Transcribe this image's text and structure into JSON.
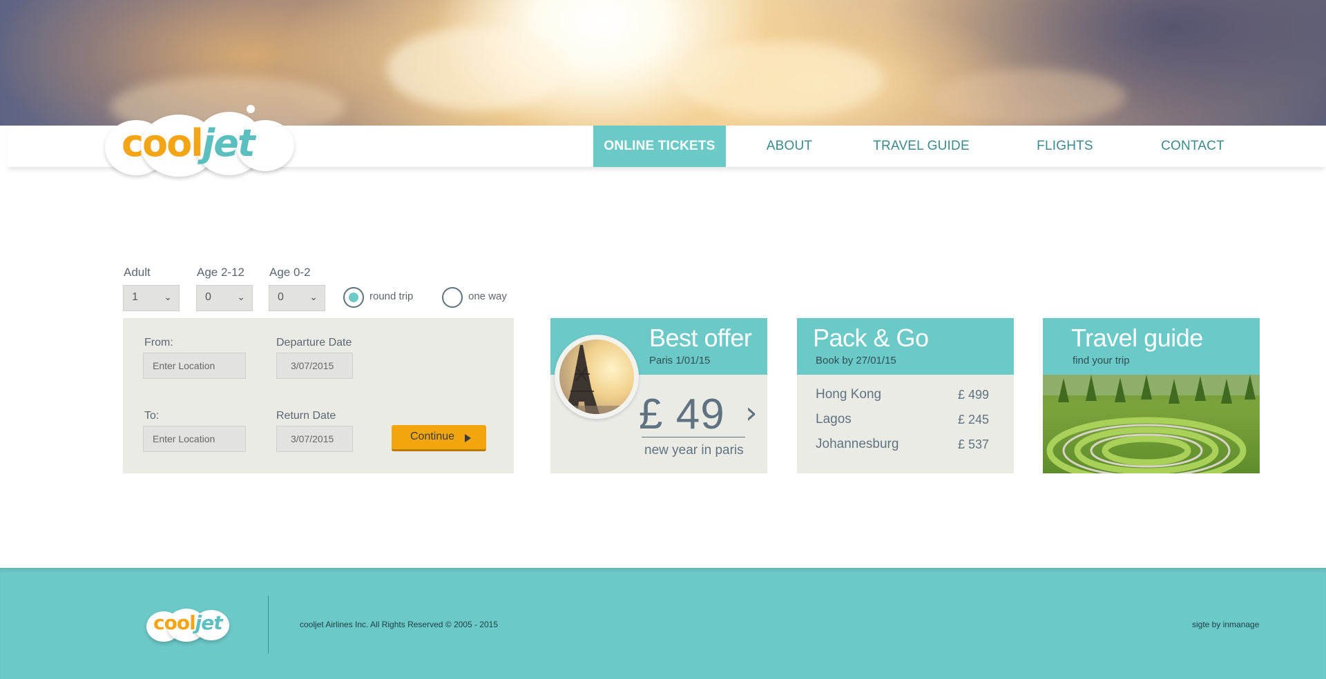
{
  "brand": {
    "logo_text_a": "cool",
    "logo_text_b": "jet"
  },
  "nav": {
    "items": [
      {
        "label": "ONLINE TICKETS",
        "active": true
      },
      {
        "label": "ABOUT",
        "active": false
      },
      {
        "label": "TRAVEL GUIDE",
        "active": false
      },
      {
        "label": "FLIGHTS",
        "active": false
      },
      {
        "label": "CONTACT",
        "active": false
      }
    ]
  },
  "passengers": {
    "adult": {
      "label": "Adult",
      "value": "1"
    },
    "child": {
      "label": "Age 2-12",
      "value": "0"
    },
    "infant": {
      "label": "Age 0-2",
      "value": "0"
    }
  },
  "trip_type": {
    "round_trip": {
      "label": "round trip",
      "selected": true
    },
    "one_way": {
      "label": "one way",
      "selected": false
    }
  },
  "search": {
    "from_label": "From:",
    "from_placeholder": "Enter Location",
    "to_label": "To:",
    "to_placeholder": "Enter Location",
    "departure_label": "Departure Date",
    "departure_value": "3/07/2015",
    "return_label": "Return Date",
    "return_value": "3/07/2015",
    "continue_label": "Continue"
  },
  "best_offer": {
    "title": "Best offer",
    "subtitle": "Paris 1/01/15",
    "price": "£ 49",
    "arrow": "›",
    "caption": "new year in paris"
  },
  "pack_go": {
    "title": "Pack & Go",
    "subtitle": "Book by 27/01/15",
    "destinations": [
      {
        "city": "Hong Kong",
        "price": "£ 499"
      },
      {
        "city": "Lagos",
        "price": "£ 245"
      },
      {
        "city": "Johannesburg",
        "price": "£ 537"
      }
    ]
  },
  "travel_guide": {
    "title": "Travel guide",
    "subtitle": "find your trip"
  },
  "footer": {
    "copyright": "cooljet Airlines Inc. All Rights Reserved © 2005 - 2015",
    "credit": "sigte by inmanage"
  },
  "colors": {
    "accent": "#6bc9c8",
    "button": "#f3a60c",
    "logo_orange": "#f3a515",
    "logo_teal": "#5bbfc0"
  },
  "icons": {
    "select_chevron": "chevron-down-icon",
    "continue_arrow": "play-arrow-icon",
    "offer_arrow": "chevron-right-icon"
  }
}
